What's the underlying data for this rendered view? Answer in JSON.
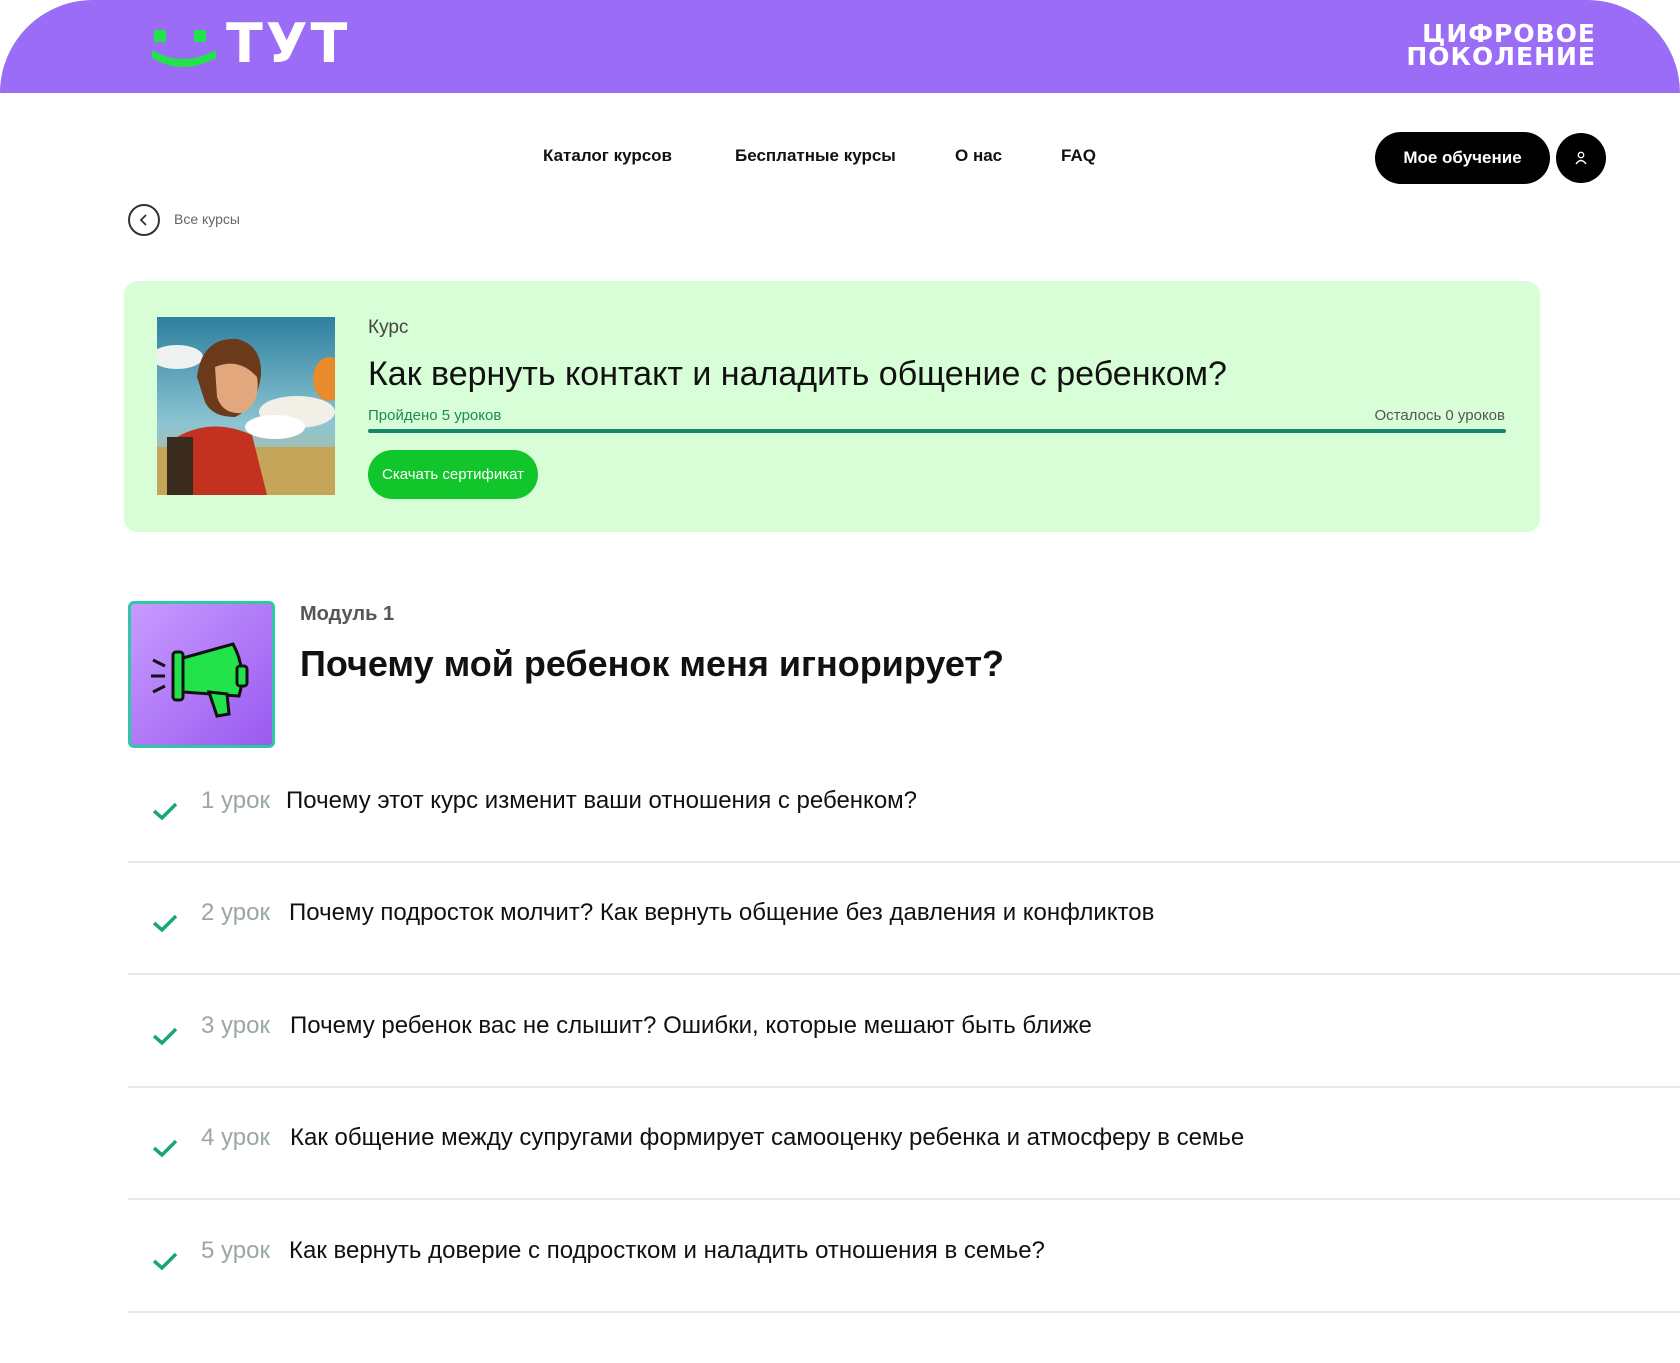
{
  "brand": {
    "logo_text": "ТУТ",
    "partner_line1": "ЦИФРОВОЕ",
    "partner_line2": "ПОКОЛЕНИЕ"
  },
  "nav": {
    "items": [
      "Каталог курсов",
      "Бесплатные курсы",
      "О нас",
      "FAQ"
    ],
    "my_learning": "Мое обучение"
  },
  "breadcrumb": {
    "back_label": "Все курсы"
  },
  "course": {
    "kind": "Курс",
    "title": "Как вернуть контакт и наладить общение с ребенком?",
    "progress_done": "Пройдено 5 уроков",
    "progress_left": "Осталось 0 уроков",
    "progress_fraction": 1.0,
    "certificate_button": "Скачать сертификат"
  },
  "module": {
    "label": "Модуль 1",
    "title": "Почему мой ребенок меня игнорирует?",
    "icon": "megaphone-icon"
  },
  "lessons": [
    {
      "num": "1 урок",
      "title": "Почему этот курс изменит ваши отношения с ребенком?",
      "completed": true
    },
    {
      "num": "2 урок",
      "title": "Почему подросток молчит? Как вернуть общение без давления и конфликтов",
      "completed": true
    },
    {
      "num": "3 урок",
      "title": "Почему ребенок вас не слышит? Ошибки, которые мешают быть ближе",
      "completed": true
    },
    {
      "num": "4 урок",
      "title": "Как общение между супругами формирует самооценку ребенка и атмосферу в семье",
      "completed": true
    },
    {
      "num": "5 урок",
      "title": "Как вернуть доверие с подростком и наладить отношения в семье?",
      "completed": true
    }
  ],
  "colors": {
    "header": "#9b6cf5",
    "logo_green": "#22e34a",
    "card_bg": "#d8fed7",
    "progress": "#17856e",
    "cert_button": "#11c62a",
    "check": "#1aa672"
  }
}
